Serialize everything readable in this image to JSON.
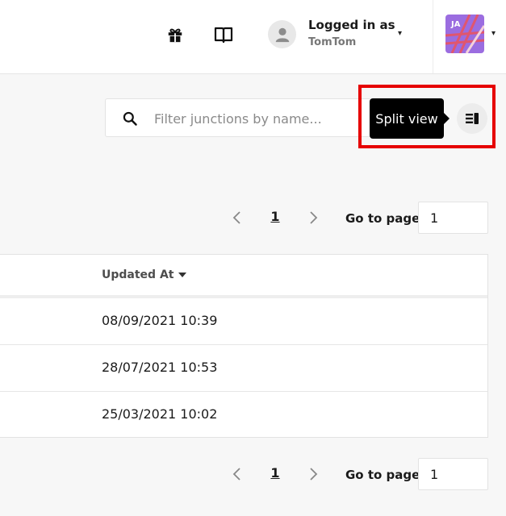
{
  "header": {
    "gift_icon": "gift-icon",
    "docs_icon": "book-icon",
    "user": {
      "logged_in_label": "Logged in as",
      "username": "TomTom",
      "caret": "▾"
    },
    "org": {
      "initials": "JA",
      "caret": "▾"
    }
  },
  "filter": {
    "placeholder": "Filter junctions by name...",
    "value": ""
  },
  "split_view": {
    "tooltip": "Split view"
  },
  "pagination": {
    "current_page": "1",
    "goto_label": "Go to page",
    "goto_value": "1"
  },
  "table": {
    "columns": [
      {
        "label": "Updated At",
        "sort": "desc"
      }
    ],
    "rows": [
      {
        "updated_at": "08/09/2021 10:39"
      },
      {
        "updated_at": "28/07/2021 10:53"
      },
      {
        "updated_at": "25/03/2021 10:02"
      }
    ]
  },
  "colors": {
    "highlight": "#e60000",
    "tooltip_bg": "#000000",
    "org_logo_bg": "#9b6de0",
    "org_logo_stripes": "#e0566e"
  }
}
